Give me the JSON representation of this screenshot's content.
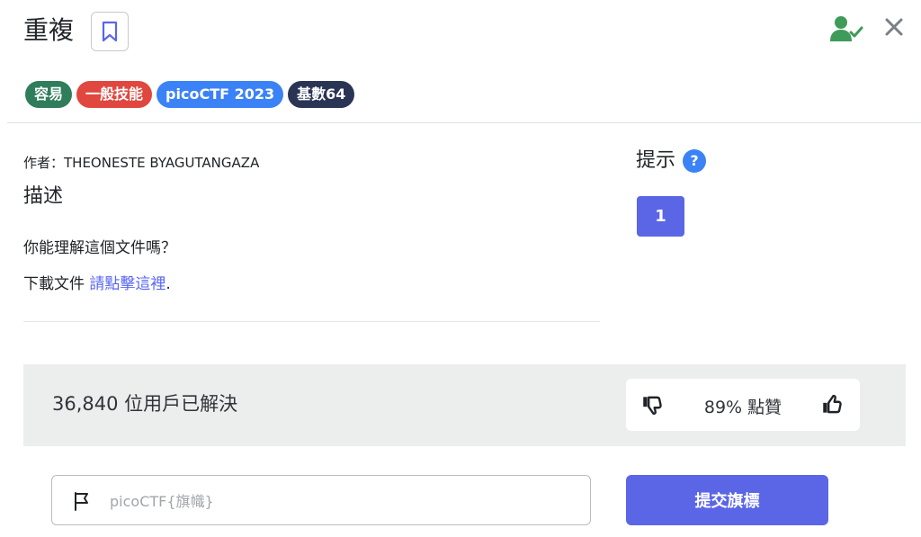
{
  "header": {
    "title": "重複",
    "tags": [
      {
        "label": "容易",
        "color": "#2f7d5b"
      },
      {
        "label": "一般技能",
        "color": "#e0473f"
      },
      {
        "label": "picoCTF 2023",
        "color": "#3b82f6"
      },
      {
        "label": "基數64",
        "color": "#2a3555"
      }
    ]
  },
  "description": {
    "author": "作者：THEONESTE BYAGUTANGAZA",
    "heading": "描述",
    "line1": "你能理解這個文件嗎？",
    "line2_prefix": "下載文件 ",
    "line2_link": "請點擊這裡",
    "line2_suffix": "."
  },
  "hints": {
    "heading": "提示",
    "help_symbol": "?",
    "items": [
      "1"
    ]
  },
  "stats": {
    "solved_text": "36,840 位用戶已解決",
    "rating_text": "89% 點贊"
  },
  "submission": {
    "placeholder": "picoCTF{旗幟}",
    "submit_label": "提交旗標"
  },
  "icons": {
    "bookmark": "bookmark-icon",
    "user_check": "user-check-icon",
    "close": "close-icon",
    "thumb_down": "thumbs-down-icon",
    "thumb_up": "thumbs-up-icon",
    "flag": "flag-icon"
  },
  "colors": {
    "accent": "#5b66e6",
    "user_check": "#3f9b5a"
  }
}
